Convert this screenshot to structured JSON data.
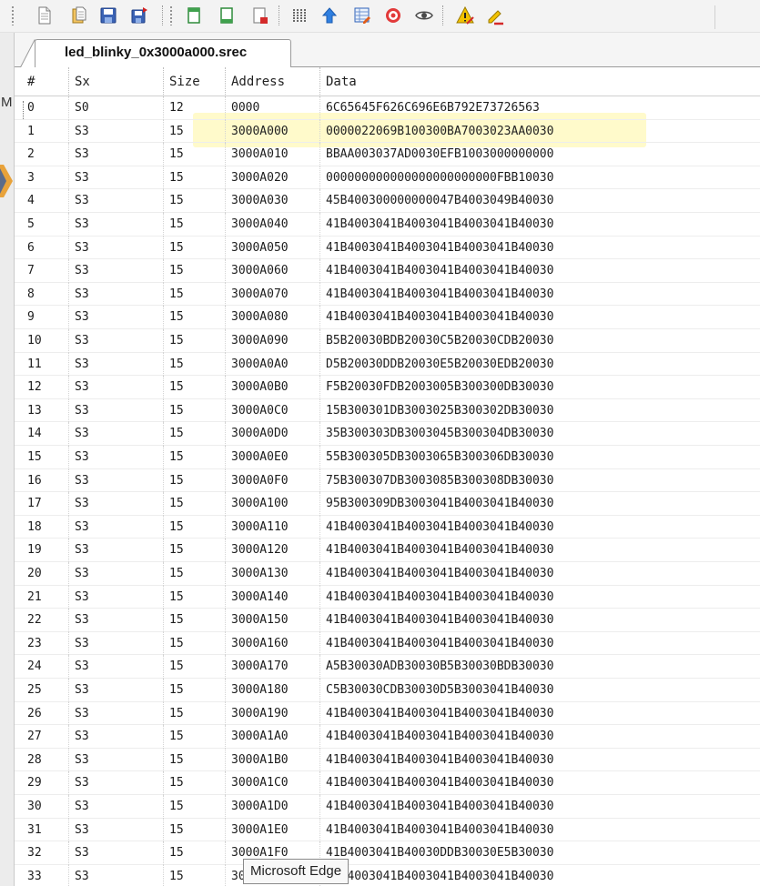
{
  "window": {
    "tab_title": "led_blinky_0x3000a000.srec",
    "left_strip_letter": "M"
  },
  "toolbar": {
    "buttons": [
      {
        "name": "new-file-icon"
      },
      {
        "name": "open-file-icon"
      },
      {
        "name": "save-icon"
      },
      {
        "name": "save-as-icon"
      },
      {
        "name": "page-icon"
      },
      {
        "name": "page-add-icon"
      },
      {
        "name": "page-remove-icon"
      },
      {
        "name": "columns-icon"
      },
      {
        "name": "arrow-up-icon"
      },
      {
        "name": "table-edit-icon"
      },
      {
        "name": "target-icon"
      },
      {
        "name": "eye-icon"
      },
      {
        "name": "warning-icon"
      },
      {
        "name": "pencil-error-icon"
      }
    ]
  },
  "table": {
    "columns": [
      "#",
      "Sx",
      "Size",
      "Address",
      "Data"
    ],
    "rows": [
      [
        "0",
        "S0",
        "12",
        "0000",
        "6C65645F626C696E6B792E73726563"
      ],
      [
        "1",
        "S3",
        "15",
        "3000A000",
        "0000022069B100300BA7003023AA0030"
      ],
      [
        "2",
        "S3",
        "15",
        "3000A010",
        "BBAA003037AD0030EFB1003000000000"
      ],
      [
        "3",
        "S3",
        "15",
        "3000A020",
        "000000000000000000000000FBB10030"
      ],
      [
        "4",
        "S3",
        "15",
        "3000A030",
        "45B400300000000047B4003049B40030"
      ],
      [
        "5",
        "S3",
        "15",
        "3000A040",
        "41B4003041B4003041B4003041B40030"
      ],
      [
        "6",
        "S3",
        "15",
        "3000A050",
        "41B4003041B4003041B4003041B40030"
      ],
      [
        "7",
        "S3",
        "15",
        "3000A060",
        "41B4003041B4003041B4003041B40030"
      ],
      [
        "8",
        "S3",
        "15",
        "3000A070",
        "41B4003041B4003041B4003041B40030"
      ],
      [
        "9",
        "S3",
        "15",
        "3000A080",
        "41B4003041B4003041B4003041B40030"
      ],
      [
        "10",
        "S3",
        "15",
        "3000A090",
        "B5B20030BDB20030C5B20030CDB20030"
      ],
      [
        "11",
        "S3",
        "15",
        "3000A0A0",
        "D5B20030DDB20030E5B20030EDB20030"
      ],
      [
        "12",
        "S3",
        "15",
        "3000A0B0",
        "F5B20030FDB2003005B300300DB30030"
      ],
      [
        "13",
        "S3",
        "15",
        "3000A0C0",
        "15B300301DB3003025B300302DB30030"
      ],
      [
        "14",
        "S3",
        "15",
        "3000A0D0",
        "35B300303DB3003045B300304DB30030"
      ],
      [
        "15",
        "S3",
        "15",
        "3000A0E0",
        "55B300305DB3003065B300306DB30030"
      ],
      [
        "16",
        "S3",
        "15",
        "3000A0F0",
        "75B300307DB3003085B300308DB30030"
      ],
      [
        "17",
        "S3",
        "15",
        "3000A100",
        "95B300309DB3003041B4003041B40030"
      ],
      [
        "18",
        "S3",
        "15",
        "3000A110",
        "41B4003041B4003041B4003041B40030"
      ],
      [
        "19",
        "S3",
        "15",
        "3000A120",
        "41B4003041B4003041B4003041B40030"
      ],
      [
        "20",
        "S3",
        "15",
        "3000A130",
        "41B4003041B4003041B4003041B40030"
      ],
      [
        "21",
        "S3",
        "15",
        "3000A140",
        "41B4003041B4003041B4003041B40030"
      ],
      [
        "22",
        "S3",
        "15",
        "3000A150",
        "41B4003041B4003041B4003041B40030"
      ],
      [
        "23",
        "S3",
        "15",
        "3000A160",
        "41B4003041B4003041B4003041B40030"
      ],
      [
        "24",
        "S3",
        "15",
        "3000A170",
        "A5B30030ADB30030B5B30030BDB30030"
      ],
      [
        "25",
        "S3",
        "15",
        "3000A180",
        "C5B30030CDB30030D5B3003041B40030"
      ],
      [
        "26",
        "S3",
        "15",
        "3000A190",
        "41B4003041B4003041B4003041B40030"
      ],
      [
        "27",
        "S3",
        "15",
        "3000A1A0",
        "41B4003041B4003041B4003041B40030"
      ],
      [
        "28",
        "S3",
        "15",
        "3000A1B0",
        "41B4003041B4003041B4003041B40030"
      ],
      [
        "29",
        "S3",
        "15",
        "3000A1C0",
        "41B4003041B4003041B4003041B40030"
      ],
      [
        "30",
        "S3",
        "15",
        "3000A1D0",
        "41B4003041B4003041B4003041B40030"
      ],
      [
        "31",
        "S3",
        "15",
        "3000A1E0",
        "41B4003041B4003041B4003041B40030"
      ],
      [
        "32",
        "S3",
        "15",
        "3000A1F0",
        "41B4003041B40030DDB30030E5B30030"
      ],
      [
        "33",
        "S3",
        "15",
        "3000A200",
        "41B4003041B4003041B4003041B40030"
      ]
    ],
    "highlighted_row": 1
  },
  "tooltip": {
    "text": "Microsoft Edge"
  },
  "colors": {
    "toolbar_bg": "#f3f3f3",
    "highlight": "#fff38c",
    "grid_line": "#d4d4d4"
  }
}
